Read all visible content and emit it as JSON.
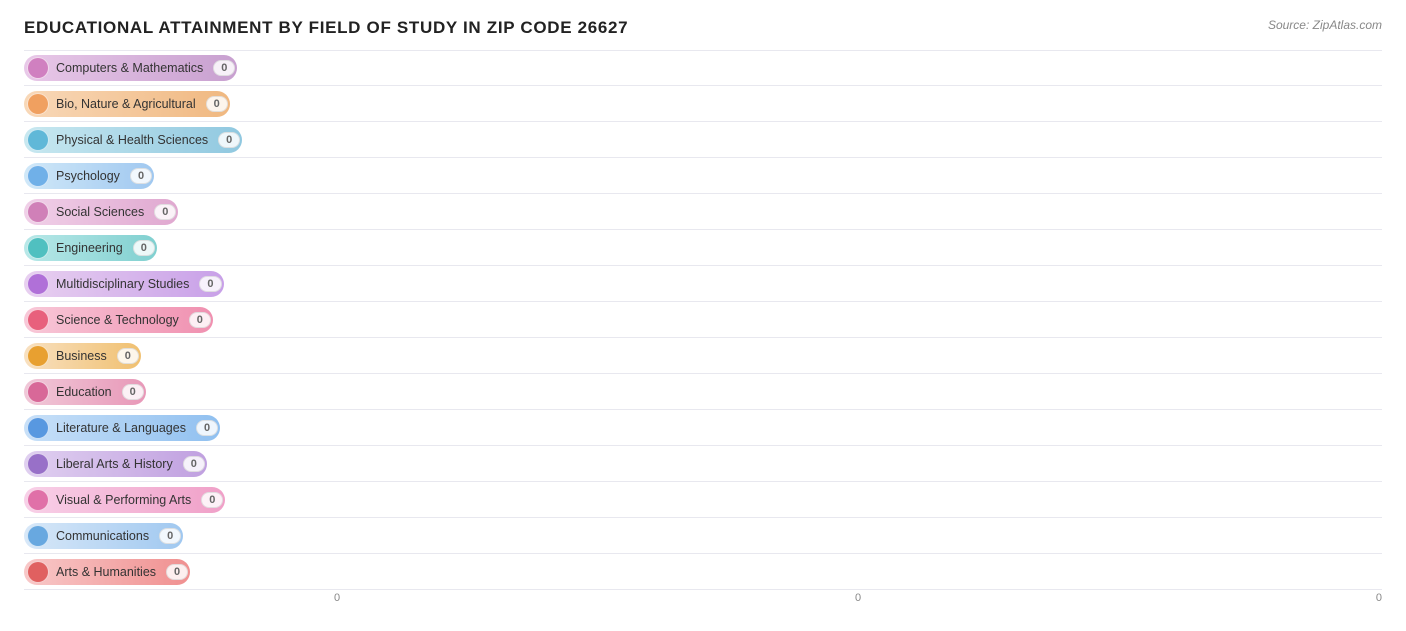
{
  "header": {
    "title": "EDUCATIONAL ATTAINMENT BY FIELD OF STUDY IN ZIP CODE 26627",
    "source_label": "Source: ZipAtlas.com"
  },
  "chart": {
    "x_axis_labels": [
      "0",
      "0",
      "0"
    ],
    "rows": [
      {
        "label": "Computers & Mathematics",
        "value": "0",
        "color_class": "row-0"
      },
      {
        "label": "Bio, Nature & Agricultural",
        "value": "0",
        "color_class": "row-1"
      },
      {
        "label": "Physical & Health Sciences",
        "value": "0",
        "color_class": "row-2"
      },
      {
        "label": "Psychology",
        "value": "0",
        "color_class": "row-3"
      },
      {
        "label": "Social Sciences",
        "value": "0",
        "color_class": "row-4"
      },
      {
        "label": "Engineering",
        "value": "0",
        "color_class": "row-5"
      },
      {
        "label": "Multidisciplinary Studies",
        "value": "0",
        "color_class": "row-6"
      },
      {
        "label": "Science & Technology",
        "value": "0",
        "color_class": "row-7"
      },
      {
        "label": "Business",
        "value": "0",
        "color_class": "row-8"
      },
      {
        "label": "Education",
        "value": "0",
        "color_class": "row-9"
      },
      {
        "label": "Literature & Languages",
        "value": "0",
        "color_class": "row-10"
      },
      {
        "label": "Liberal Arts & History",
        "value": "0",
        "color_class": "row-11"
      },
      {
        "label": "Visual & Performing Arts",
        "value": "0",
        "color_class": "row-12"
      },
      {
        "label": "Communications",
        "value": "0",
        "color_class": "row-13"
      },
      {
        "label": "Arts & Humanities",
        "value": "0",
        "color_class": "row-15"
      }
    ]
  }
}
